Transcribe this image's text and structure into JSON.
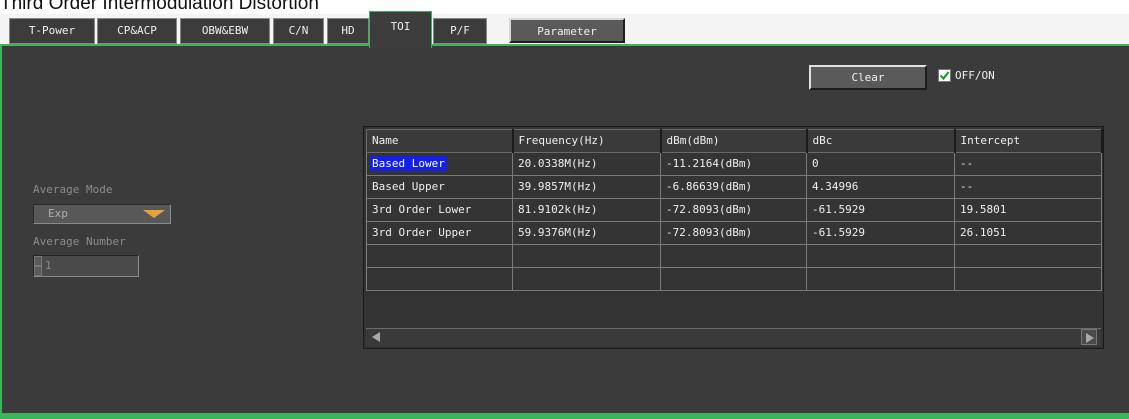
{
  "window": {
    "title": "Third Order Intermodulation Distortion"
  },
  "tabs": [
    {
      "label": "T-Power"
    },
    {
      "label": "CP&ACP"
    },
    {
      "label": "OBW&EBW"
    },
    {
      "label": "C/N"
    },
    {
      "label": "HD"
    },
    {
      "label": "TOI",
      "active": true
    },
    {
      "label": "P/F"
    }
  ],
  "toolbar": {
    "parameter_label": "Parameter"
  },
  "controls": {
    "clear_label": "Clear",
    "onoff_label": "OFF/ON",
    "onoff_checked": true,
    "average_mode_label": "Average Mode",
    "average_mode_value": "Exp",
    "average_number_label": "Average Number",
    "average_number_value": "1"
  },
  "table": {
    "columns": [
      "Name",
      "Frequency(Hz)",
      "dBm(dBm)",
      "dBc",
      "Intercept"
    ],
    "rows": [
      [
        "Based Lower",
        "20.0338M(Hz)",
        "-11.2164(dBm)",
        "0",
        "--"
      ],
      [
        "Based Upper",
        "39.9857M(Hz)",
        "-6.86639(dBm)",
        "4.34996",
        "--"
      ],
      [
        "3rd Order Lower",
        "81.9102k(Hz)",
        "-72.8093(dBm)",
        "-61.5929",
        "19.5801"
      ],
      [
        "3rd Order Upper",
        "59.9376M(Hz)",
        "-72.8093(dBm)",
        "-61.5929",
        "26.1051"
      ],
      [
        "",
        "",
        "",
        "",
        ""
      ],
      [
        "",
        "",
        "",
        "",
        ""
      ]
    ],
    "selected_row": 0
  },
  "colors": {
    "accent": "#3ab55a",
    "panel": "#3b3b3b",
    "selection": "#1420e8",
    "dropdown_arrow": "#e6a33a"
  },
  "icons": {
    "checkbox": "check-icon",
    "dropdown": "dropdown-arrow-icon",
    "scroll_left": "scroll-left-icon",
    "scroll_right": "scroll-right-icon"
  }
}
